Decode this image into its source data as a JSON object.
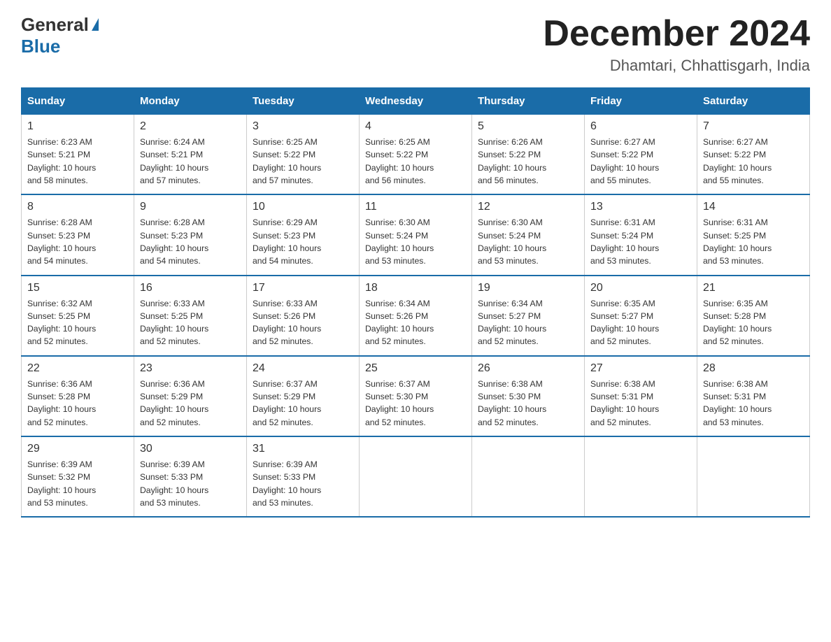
{
  "logo": {
    "general": "General",
    "blue": "Blue"
  },
  "title": "December 2024",
  "subtitle": "Dhamtari, Chhattisgarh, India",
  "days_of_week": [
    "Sunday",
    "Monday",
    "Tuesday",
    "Wednesday",
    "Thursday",
    "Friday",
    "Saturday"
  ],
  "weeks": [
    [
      {
        "day": "1",
        "info": "Sunrise: 6:23 AM\nSunset: 5:21 PM\nDaylight: 10 hours\nand 58 minutes."
      },
      {
        "day": "2",
        "info": "Sunrise: 6:24 AM\nSunset: 5:21 PM\nDaylight: 10 hours\nand 57 minutes."
      },
      {
        "day": "3",
        "info": "Sunrise: 6:25 AM\nSunset: 5:22 PM\nDaylight: 10 hours\nand 57 minutes."
      },
      {
        "day": "4",
        "info": "Sunrise: 6:25 AM\nSunset: 5:22 PM\nDaylight: 10 hours\nand 56 minutes."
      },
      {
        "day": "5",
        "info": "Sunrise: 6:26 AM\nSunset: 5:22 PM\nDaylight: 10 hours\nand 56 minutes."
      },
      {
        "day": "6",
        "info": "Sunrise: 6:27 AM\nSunset: 5:22 PM\nDaylight: 10 hours\nand 55 minutes."
      },
      {
        "day": "7",
        "info": "Sunrise: 6:27 AM\nSunset: 5:22 PM\nDaylight: 10 hours\nand 55 minutes."
      }
    ],
    [
      {
        "day": "8",
        "info": "Sunrise: 6:28 AM\nSunset: 5:23 PM\nDaylight: 10 hours\nand 54 minutes."
      },
      {
        "day": "9",
        "info": "Sunrise: 6:28 AM\nSunset: 5:23 PM\nDaylight: 10 hours\nand 54 minutes."
      },
      {
        "day": "10",
        "info": "Sunrise: 6:29 AM\nSunset: 5:23 PM\nDaylight: 10 hours\nand 54 minutes."
      },
      {
        "day": "11",
        "info": "Sunrise: 6:30 AM\nSunset: 5:24 PM\nDaylight: 10 hours\nand 53 minutes."
      },
      {
        "day": "12",
        "info": "Sunrise: 6:30 AM\nSunset: 5:24 PM\nDaylight: 10 hours\nand 53 minutes."
      },
      {
        "day": "13",
        "info": "Sunrise: 6:31 AM\nSunset: 5:24 PM\nDaylight: 10 hours\nand 53 minutes."
      },
      {
        "day": "14",
        "info": "Sunrise: 6:31 AM\nSunset: 5:25 PM\nDaylight: 10 hours\nand 53 minutes."
      }
    ],
    [
      {
        "day": "15",
        "info": "Sunrise: 6:32 AM\nSunset: 5:25 PM\nDaylight: 10 hours\nand 52 minutes."
      },
      {
        "day": "16",
        "info": "Sunrise: 6:33 AM\nSunset: 5:25 PM\nDaylight: 10 hours\nand 52 minutes."
      },
      {
        "day": "17",
        "info": "Sunrise: 6:33 AM\nSunset: 5:26 PM\nDaylight: 10 hours\nand 52 minutes."
      },
      {
        "day": "18",
        "info": "Sunrise: 6:34 AM\nSunset: 5:26 PM\nDaylight: 10 hours\nand 52 minutes."
      },
      {
        "day": "19",
        "info": "Sunrise: 6:34 AM\nSunset: 5:27 PM\nDaylight: 10 hours\nand 52 minutes."
      },
      {
        "day": "20",
        "info": "Sunrise: 6:35 AM\nSunset: 5:27 PM\nDaylight: 10 hours\nand 52 minutes."
      },
      {
        "day": "21",
        "info": "Sunrise: 6:35 AM\nSunset: 5:28 PM\nDaylight: 10 hours\nand 52 minutes."
      }
    ],
    [
      {
        "day": "22",
        "info": "Sunrise: 6:36 AM\nSunset: 5:28 PM\nDaylight: 10 hours\nand 52 minutes."
      },
      {
        "day": "23",
        "info": "Sunrise: 6:36 AM\nSunset: 5:29 PM\nDaylight: 10 hours\nand 52 minutes."
      },
      {
        "day": "24",
        "info": "Sunrise: 6:37 AM\nSunset: 5:29 PM\nDaylight: 10 hours\nand 52 minutes."
      },
      {
        "day": "25",
        "info": "Sunrise: 6:37 AM\nSunset: 5:30 PM\nDaylight: 10 hours\nand 52 minutes."
      },
      {
        "day": "26",
        "info": "Sunrise: 6:38 AM\nSunset: 5:30 PM\nDaylight: 10 hours\nand 52 minutes."
      },
      {
        "day": "27",
        "info": "Sunrise: 6:38 AM\nSunset: 5:31 PM\nDaylight: 10 hours\nand 52 minutes."
      },
      {
        "day": "28",
        "info": "Sunrise: 6:38 AM\nSunset: 5:31 PM\nDaylight: 10 hours\nand 53 minutes."
      }
    ],
    [
      {
        "day": "29",
        "info": "Sunrise: 6:39 AM\nSunset: 5:32 PM\nDaylight: 10 hours\nand 53 minutes."
      },
      {
        "day": "30",
        "info": "Sunrise: 6:39 AM\nSunset: 5:33 PM\nDaylight: 10 hours\nand 53 minutes."
      },
      {
        "day": "31",
        "info": "Sunrise: 6:39 AM\nSunset: 5:33 PM\nDaylight: 10 hours\nand 53 minutes."
      },
      null,
      null,
      null,
      null
    ]
  ]
}
